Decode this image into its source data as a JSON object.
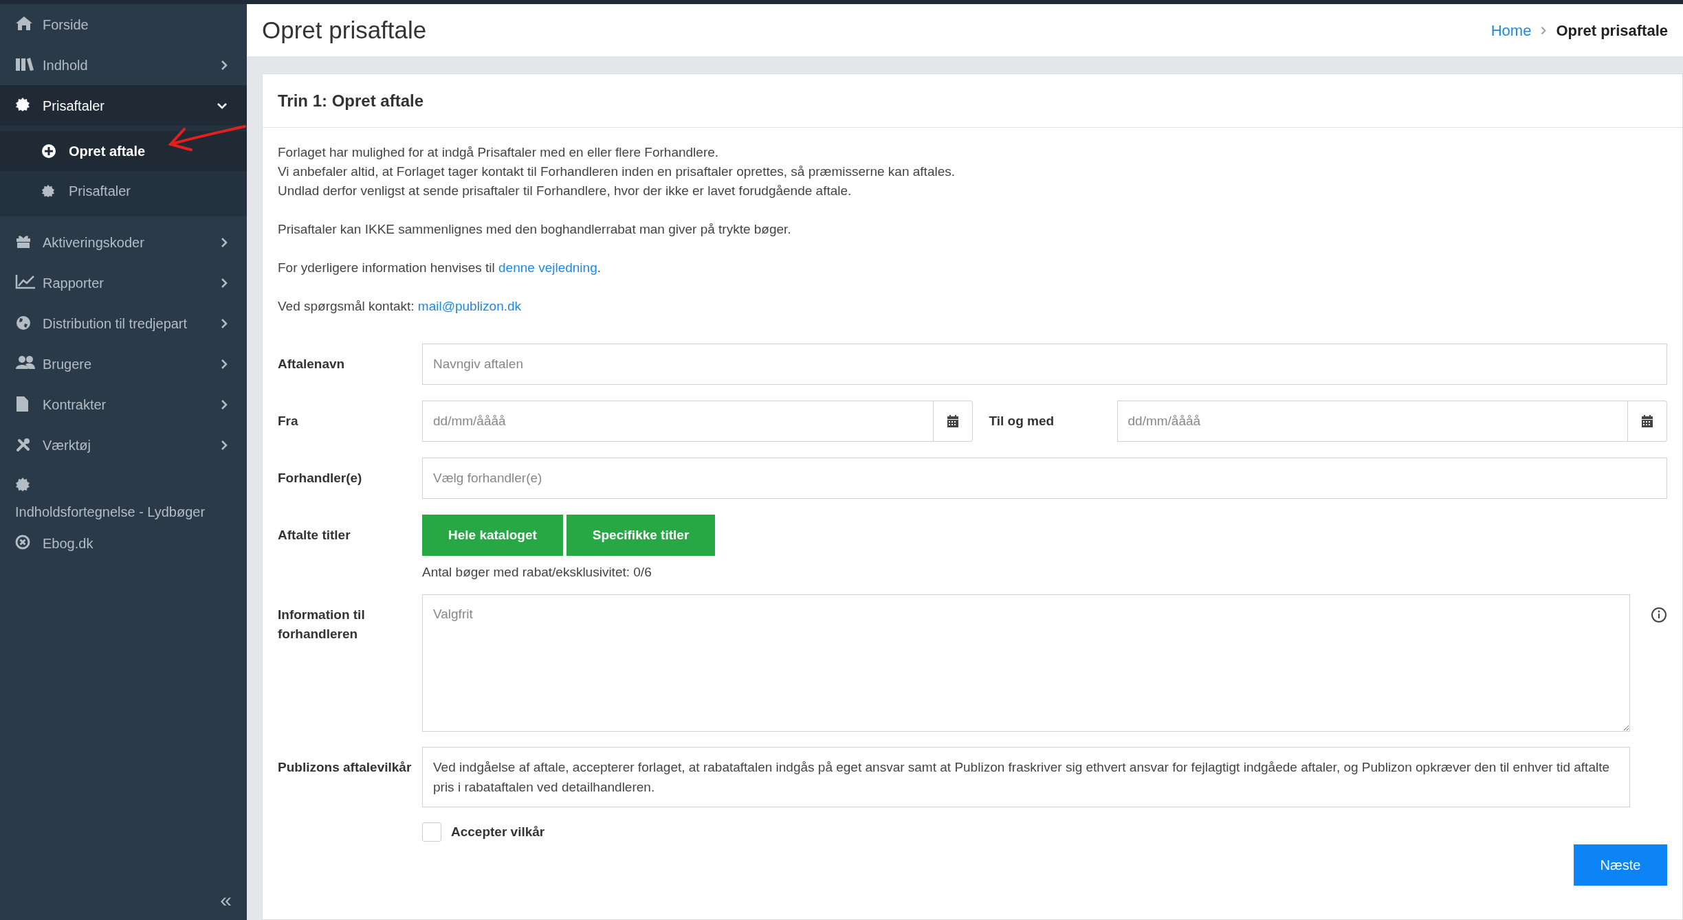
{
  "sidebar": {
    "items": [
      {
        "label": "Forside",
        "selected": false
      },
      {
        "label": "Indhold",
        "selected": false,
        "expanded": false
      },
      {
        "label": "Prisaftaler",
        "selected": true,
        "expanded": true,
        "children": [
          {
            "label": "Opret aftale",
            "selected": true
          },
          {
            "label": "Prisaftaler",
            "selected": false
          }
        ]
      },
      {
        "label": "Aktiveringskoder",
        "selected": false,
        "expanded": false
      },
      {
        "label": "Rapporter",
        "selected": false,
        "expanded": false
      },
      {
        "label": "Distribution til tredjepart",
        "selected": false,
        "expanded": false
      },
      {
        "label": "Brugere",
        "selected": false,
        "expanded": false
      },
      {
        "label": "Kontrakter",
        "selected": false,
        "expanded": false
      },
      {
        "label": "Værktøj",
        "selected": false,
        "expanded": false
      },
      {
        "label": "Indholdsfortegnelse - Lydbøger",
        "selected": false
      },
      {
        "label": "Ebog.dk",
        "selected": false
      }
    ],
    "collapse": "«"
  },
  "header": {
    "title": "Opret prisaftale",
    "breadcrumb": [
      {
        "label": "Home",
        "kind": "link"
      },
      {
        "label": "Opret prisaftale",
        "kind": "current"
      }
    ]
  },
  "card": {
    "title": "Trin 1: Opret aftale",
    "intro": [
      {
        "lines": [
          "Forlaget har mulighed for at indgå Prisaftaler med en eller flere Forhandlere.",
          "Vi anbefaler altid, at Forlaget tager kontakt til Forhandleren inden en prisaftaler oprettes, så præmisserne kan aftales.",
          "Undlad derfor venligst at sende prisaftaler til Forhandlere, hvor der ikke er lavet forudgående aftale."
        ]
      },
      {
        "lines": [
          "Prisaftaler kan IKKE sammenlignes med den boghandlerrabat man giver på trykte bøger."
        ]
      },
      {
        "text": "For yderligere information henvises til ",
        "link": "denne vejledning",
        "after": "."
      },
      {
        "text": "Ved spørgsmål kontakt: ",
        "link": "mail@publizon.dk"
      }
    ],
    "form": {
      "name": {
        "label": "Aftalenavn",
        "placeholder": "Navngiv aftalen"
      },
      "from": {
        "label": "Fra",
        "placeholder": "dd/mm/åååå"
      },
      "to": {
        "label": "Til og med",
        "placeholder": "dd/mm/åååå"
      },
      "dealers": {
        "label": "Forhandler(e)",
        "placeholder": "Vælg forhandler(e)"
      },
      "titles": {
        "label": "Aftalte titler",
        "buttons": [
          "Hele kataloget",
          "Specifikke titler"
        ],
        "count": "Antal bøger med rabat/eksklusivitet: 0/6"
      },
      "info": {
        "label": "Information til forhandleren",
        "placeholder": "Valgfrit"
      },
      "terms": {
        "label": "Publizons aftalevilkår",
        "text": "Ved indgåelse af aftale, accepterer forlaget, at rabataftalen indgås på eget ansvar samt at Publizon fraskriver sig ethvert ansvar for fejlagtigt indgåede aftaler, og Publizon opkræver den til enhver tid aftalte pris i rabataftalen ved detailhandleren."
      },
      "accept": {
        "label": "Accepter vilkår",
        "checked": false
      },
      "next": "Næste"
    }
  }
}
